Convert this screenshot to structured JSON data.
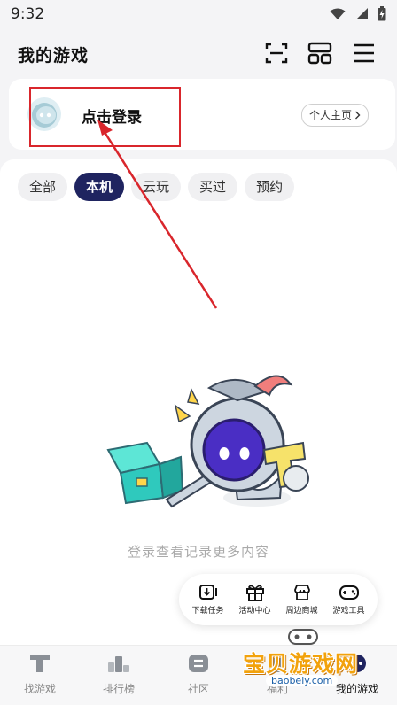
{
  "status_bar": {
    "time": "9:32"
  },
  "header": {
    "title": "我的游戏",
    "icons": [
      "scan-icon",
      "layout-grid-icon",
      "menu-icon"
    ]
  },
  "login_card": {
    "login_text": "点击登录",
    "profile_button": "个人主页",
    "avatar_icon": "robot-avatar-icon"
  },
  "filters": {
    "tabs": [
      "全部",
      "本机",
      "云玩",
      "买过",
      "预约"
    ],
    "active_index": 1
  },
  "empty_state": {
    "message": "登录查看记录更多内容"
  },
  "quick_tools": {
    "items": [
      {
        "label": "下载任务",
        "icon": "download-icon"
      },
      {
        "label": "活动中心",
        "icon": "gift-icon"
      },
      {
        "label": "周边商城",
        "icon": "shop-icon"
      },
      {
        "label": "游戏工具",
        "icon": "gamepad-icon"
      }
    ]
  },
  "bottom_nav": {
    "items": [
      {
        "label": "找游戏",
        "icon": "t-logo-icon"
      },
      {
        "label": "排行榜",
        "icon": "podium-icon"
      },
      {
        "label": "社区",
        "icon": "community-icon"
      },
      {
        "label": "福利",
        "icon": "welfare-icon"
      },
      {
        "label": "我的游戏",
        "icon": "my-games-icon"
      }
    ],
    "active_index": 4
  },
  "watermark": {
    "title": "宝贝游戏网",
    "url": "baobeiy.com"
  },
  "colors": {
    "accent": "#1f2460",
    "annotation": "#d9262c",
    "watermark": "#f2a20c"
  }
}
